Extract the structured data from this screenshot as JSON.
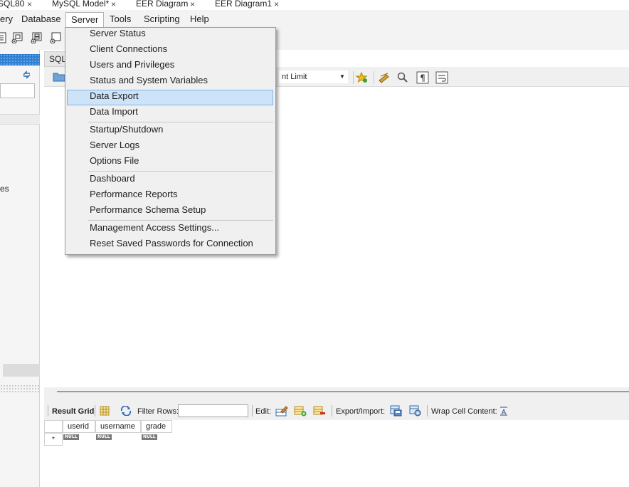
{
  "tabs": [
    {
      "label": "SQL80"
    },
    {
      "label": "MySQL Model*"
    },
    {
      "label": "EER Diagram"
    },
    {
      "label": "EER Diagram1"
    }
  ],
  "tab_close": "×",
  "menubar": {
    "items": [
      "ery",
      "Database",
      "Server",
      "Tools",
      "Scripting",
      "Help"
    ]
  },
  "sidebar": {
    "partial_text": "es"
  },
  "editor": {
    "tab_label": "SQL",
    "limit_label": "nt Limit"
  },
  "server_menu": {
    "groups": [
      [
        "Server Status",
        "Client Connections",
        "Users and Privileges",
        "Status and System Variables",
        "Data Export",
        "Data Import"
      ],
      [
        "Startup/Shutdown",
        "Server Logs",
        "Options File"
      ],
      [
        "Dashboard",
        "Performance Reports",
        "Performance Schema Setup"
      ],
      [
        "Management Access Settings...",
        "Reset Saved Passwords for Connection"
      ]
    ],
    "highlighted": "Data Export"
  },
  "result_toolbar": {
    "result_grid": "Result Grid",
    "filter_rows": "Filter Rows:",
    "edit": "Edit:",
    "export_import": "Export/Import:",
    "wrap_cell": "Wrap Cell Content:"
  },
  "grid": {
    "columns": [
      "userid",
      "username",
      "grade"
    ],
    "null_label": "NULL",
    "new_row_marker": "*"
  },
  "colors": {
    "accent": "#2f7fd0",
    "menu_highlight": "#cde3f7"
  }
}
